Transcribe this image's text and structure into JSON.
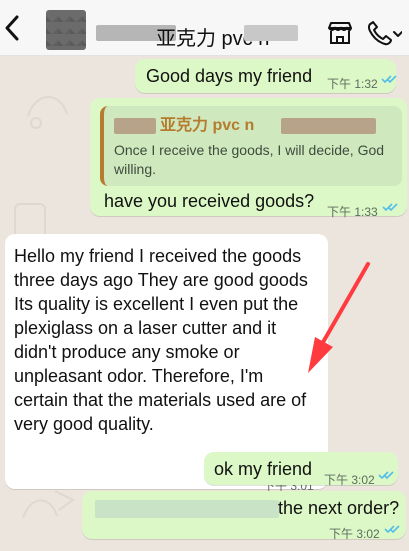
{
  "header": {
    "title": "亚克力 pvc n",
    "back_icon": "back-chevron-icon",
    "shop_icon": "shop-icon",
    "call_icon": "call-icon"
  },
  "messages": [
    {
      "direction": "out",
      "text": "Good days my friend",
      "time": "下午 1:32",
      "status": "read"
    },
    {
      "direction": "out",
      "quote_title": "亚克力 pvc n",
      "quote_text": "Once I receive the goods, I will decide, God willing.",
      "text": "have you received goods?",
      "time": "下午 1:33",
      "status": "read"
    },
    {
      "direction": "in",
      "lines": [
        "Hello my friend  I received the goods",
        "three days ago They are good goods",
        "Its quality is excellent I even put the",
        "plexiglass on a laser cutter and it",
        "didn't produce any smoke or",
        "unpleasant odor. Therefore, I'm",
        "certain that the materials used are of",
        "very good quality."
      ],
      "time": "下午 3:01"
    },
    {
      "direction": "out",
      "text": "ok my friend",
      "time": "下午 3:02",
      "status": "read"
    },
    {
      "direction": "out",
      "text": "the next order?",
      "time": "下午 3:02",
      "status": "read"
    }
  ],
  "colors": {
    "chat_background": "#ece5dd",
    "outgoing_bubble": "#dcf8c6",
    "incoming_bubble": "#ffffff",
    "read_ticks": "#53bdeb",
    "annotation_arrow": "#ff3b3f",
    "quote_accent": "#b57b2f"
  }
}
